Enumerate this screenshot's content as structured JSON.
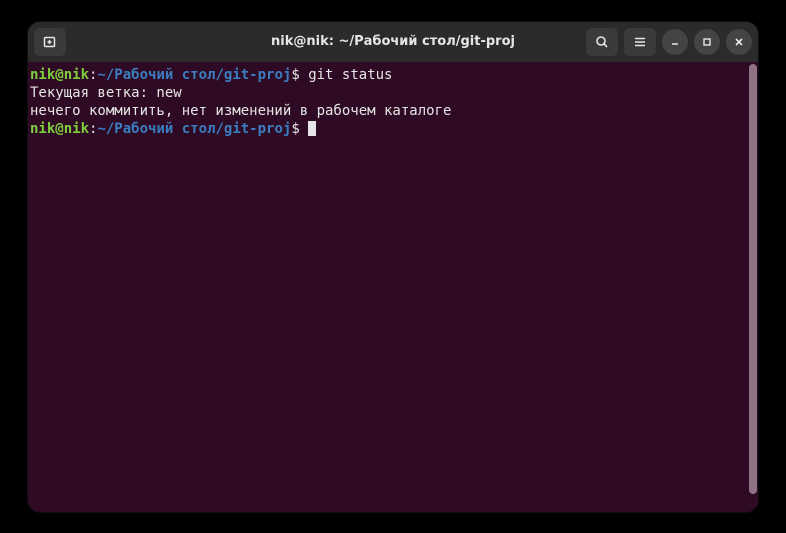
{
  "titlebar": {
    "title": "nik@nik: ~/Рабочий стол/git-proj"
  },
  "prompt": {
    "user_host": "nik@nik",
    "sep": ":",
    "path": "~/Рабочий стол/git-proj",
    "symbol": "$"
  },
  "lines": {
    "cmd1": " git status",
    "out1": "Текущая ветка: new",
    "out2": "нечего коммитить, нет изменений в рабочем каталоге"
  }
}
